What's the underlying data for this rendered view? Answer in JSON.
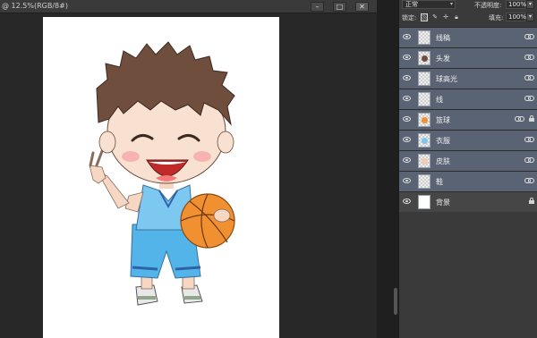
{
  "document": {
    "title": "@ 12.5%(RGB/8#)",
    "window_buttons": [
      "–",
      "□",
      "✕"
    ]
  },
  "layers_panel": {
    "blend_mode": "正常",
    "opacity_label": "不透明度:",
    "opacity_value": "100%",
    "lock_label": "锁定:",
    "fill_label": "填充:",
    "fill_value": "100%",
    "layers": [
      {
        "name": "线稿",
        "thumb": "checker",
        "linked": true,
        "locked": false,
        "selected": true
      },
      {
        "name": "头发",
        "thumb": "face",
        "linked": true,
        "locked": false,
        "selected": true
      },
      {
        "name": "球高光",
        "thumb": "checker",
        "linked": true,
        "locked": false,
        "selected": true
      },
      {
        "name": "线",
        "thumb": "checker",
        "linked": true,
        "locked": false,
        "selected": true
      },
      {
        "name": "篮球",
        "thumb": "ball",
        "linked": true,
        "locked": true,
        "selected": true
      },
      {
        "name": "衣服",
        "thumb": "cloth",
        "linked": true,
        "locked": false,
        "selected": true
      },
      {
        "name": "皮肤",
        "thumb": "skin",
        "linked": true,
        "locked": false,
        "selected": true
      },
      {
        "name": "鞋",
        "thumb": "checker",
        "linked": true,
        "locked": false,
        "selected": true
      },
      {
        "name": "背景",
        "thumb": "white",
        "linked": false,
        "locked": true,
        "selected": false
      }
    ]
  },
  "colors": {
    "selected_layer": "#5a6373",
    "panel_bg": "#3a3a3a",
    "workspace": "#282828"
  }
}
